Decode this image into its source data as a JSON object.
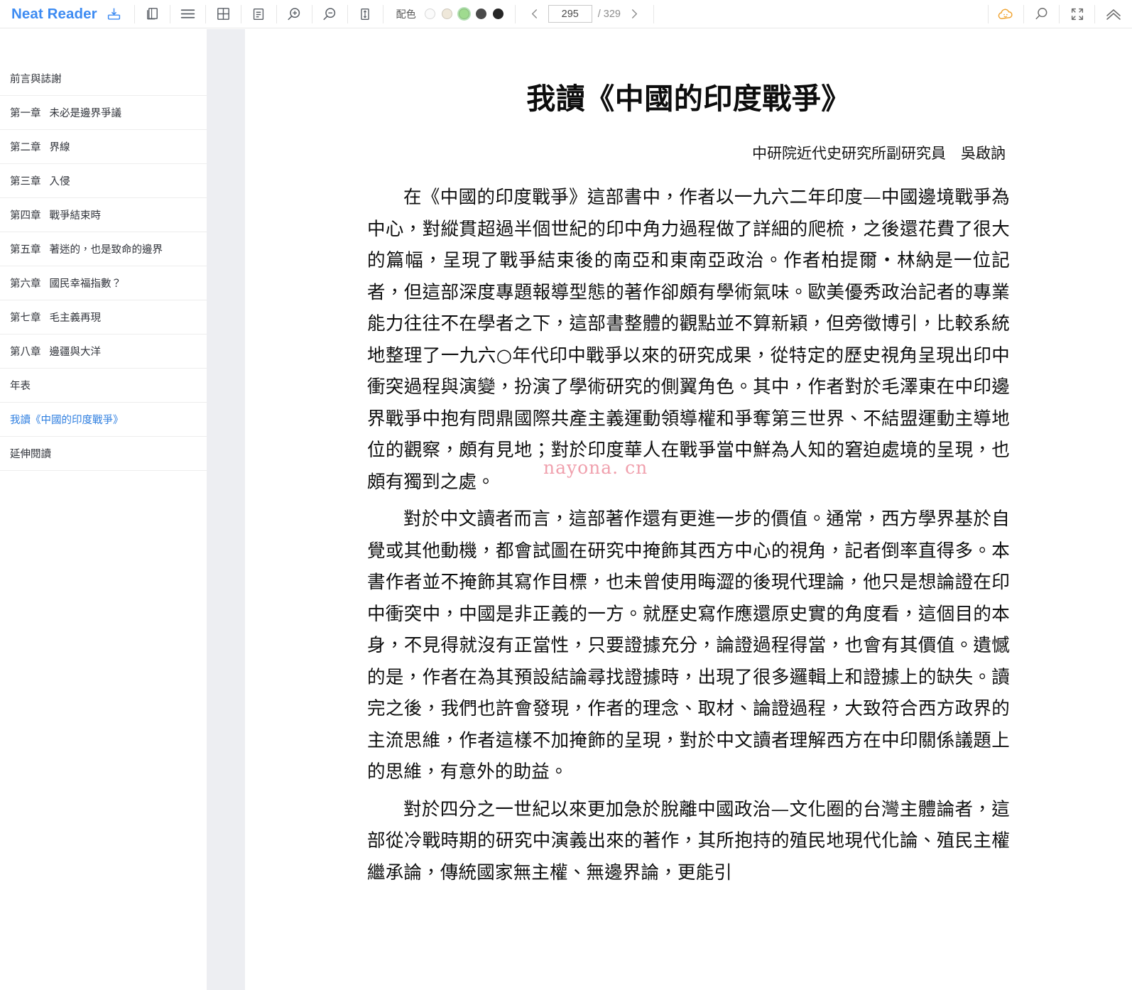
{
  "app": {
    "brand": "Neat Reader",
    "brand_color": "#3d8bf2",
    "save_icon": "save-to-library-icon"
  },
  "toolbar": {
    "buttons": [
      {
        "name": "two-page-view-button",
        "icon": "book-pages-icon",
        "title": "雙頁"
      },
      {
        "name": "toc-toggle-button",
        "icon": "hamburger-menu-icon",
        "title": "目錄"
      },
      {
        "name": "grid-layout-button",
        "icon": "grid-icon",
        "title": "版面"
      },
      {
        "name": "note-panel-button",
        "icon": "document-lines-icon",
        "title": "筆記"
      },
      {
        "name": "zoom-in-button",
        "icon": "magnifier-plus-icon",
        "title": "放大"
      },
      {
        "name": "zoom-out-button",
        "icon": "magnifier-minus-icon",
        "title": "縮小"
      },
      {
        "name": "line-height-button",
        "icon": "vertical-arrows-box-icon",
        "title": "行距"
      }
    ],
    "scheme": {
      "label": "配色",
      "options": [
        {
          "name": "scheme-white",
          "color": "#fbfbfb",
          "selected": false
        },
        {
          "name": "scheme-cream",
          "color": "#efe8da",
          "selected": false
        },
        {
          "name": "scheme-green",
          "color": "#9fdb8f",
          "selected": true
        },
        {
          "name": "scheme-gray",
          "color": "#4a4a4a",
          "selected": false
        },
        {
          "name": "scheme-black",
          "color": "#262626",
          "selected": false
        }
      ]
    },
    "pager": {
      "prev_icon": "chevron-left-icon",
      "next_icon": "chevron-right-icon",
      "current_page": "295",
      "total_label": "/ 329",
      "total_pages": "329"
    },
    "right_buttons": [
      {
        "name": "cloud-sync-button",
        "icon": "cloud-face-icon",
        "color": "#f0a22e"
      },
      {
        "name": "search-button",
        "icon": "magnifier-icon",
        "color": "#6e6e6e"
      },
      {
        "name": "fullscreen-button",
        "icon": "expand-arrows-icon",
        "color": "#6e6e6e"
      },
      {
        "name": "collapse-toolbar-button",
        "icon": "chevron-double-up-icon",
        "color": "#6e6e6e"
      }
    ]
  },
  "sidebar": {
    "items": [
      {
        "num": "",
        "title": "前言與誌謝",
        "active": false
      },
      {
        "num": "第一章",
        "title": "未必是邊界爭議",
        "active": false
      },
      {
        "num": "第二章",
        "title": "界線",
        "active": false
      },
      {
        "num": "第三章",
        "title": "入侵",
        "active": false
      },
      {
        "num": "第四章",
        "title": "戰爭結束時",
        "active": false
      },
      {
        "num": "第五章",
        "title": "著迷的，也是致命的邊界",
        "active": false
      },
      {
        "num": "第六章",
        "title": "國民幸福指數？",
        "active": false
      },
      {
        "num": "第七章",
        "title": "毛主義再現",
        "active": false
      },
      {
        "num": "第八章",
        "title": "邊疆與大洋",
        "active": false
      },
      {
        "num": "",
        "title": "年表",
        "active": false
      },
      {
        "num": "",
        "title": "我讀《中國的印度戰爭》",
        "active": true
      },
      {
        "num": "",
        "title": "延伸閱讀",
        "active": false
      }
    ]
  },
  "content": {
    "title": "我讀《中國的印度戰爭》",
    "byline": "中研院近代史研究所副研究員　吳啟訥",
    "watermark": "nayona. cn",
    "paragraphs": [
      "在《中國的印度戰爭》這部書中，作者以一九六二年印度—中國邊境戰爭為中心，對縱貫超過半個世紀的印中角力過程做了詳細的爬梳，之後還花費了很大的篇幅，呈現了戰爭結束後的南亞和東南亞政治。作者柏提爾・林納是一位記者，但這部深度專題報導型態的著作卻頗有學術氣味。歐美優秀政治記者的專業能力往往不在學者之下，這部書整體的觀點並不算新穎，但旁徵博引，比較系統地整理了一九六○年代印中戰爭以來的研究成果，從特定的歷史視角呈現出印中衝突過程與演變，扮演了學術研究的側翼角色。其中，作者對於毛澤東在中印邊界戰爭中抱有問鼎國際共產主義運動領導權和爭奪第三世界、不結盟運動主導地位的觀察，頗有見地；對於印度華人在戰爭當中鮮為人知的窘迫處境的呈現，也頗有獨到之處。",
      "對於中文讀者而言，這部著作還有更進一步的價值。通常，西方學界基於自覺或其他動機，都會試圖在研究中掩飾其西方中心的視角，記者倒率直得多。本書作者並不掩飾其寫作目標，也未曾使用晦澀的後現代理論，他只是想論證在印中衝突中，中國是非正義的一方。就歷史寫作應還原史實的角度看，這個目的本身，不見得就沒有正當性，只要證據充分，論證過程得當，也會有其價值。遺憾的是，作者在為其預設結論尋找證據時，出現了很多邏輯上和證據上的缺失。讀完之後，我們也許會發現，作者的理念、取材、論證過程，大致符合西方政界的主流思維，作者這樣不加掩飾的呈現，對於中文讀者理解西方在中印關係議題上的思維，有意外的助益。",
      "對於四分之一世紀以來更加急於脫離中國政治—文化圈的台灣主體論者，這部從冷戰時期的研究中演義出來的著作，其所抱持的殖民地現代化論、殖民主權繼承論，傳統國家無主權、無邊界論，更能引"
    ]
  }
}
